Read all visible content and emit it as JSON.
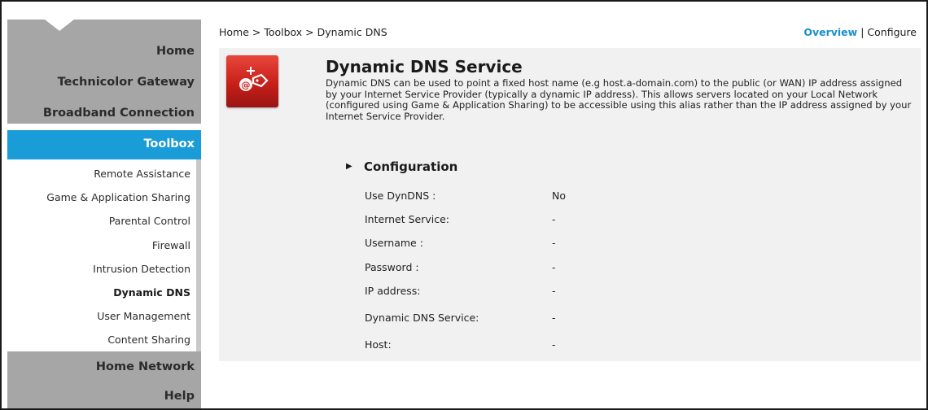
{
  "sidebar": {
    "headers": [
      "Home",
      "Technicolor Gateway",
      "Broadband Connection"
    ],
    "active_section": "Toolbox",
    "items": [
      {
        "label": "Remote Assistance"
      },
      {
        "label": "Game & Application Sharing"
      },
      {
        "label": "Parental Control"
      },
      {
        "label": "Firewall"
      },
      {
        "label": "Intrusion Detection"
      },
      {
        "label": "Dynamic DNS",
        "active": true
      },
      {
        "label": "User Management"
      },
      {
        "label": "Content Sharing"
      }
    ],
    "footer": [
      "Home Network",
      "Help"
    ]
  },
  "breadcrumb": "Home > Toolbox > Dynamic DNS",
  "top_links": {
    "overview": "Overview",
    "separator": "|",
    "configure": "Configure"
  },
  "service": {
    "icon": "dns-at-tag-icon",
    "title": "Dynamic DNS Service",
    "description": "Dynamic DNS can be used to point a fixed host name (e.g host.a-domain.com) to the public (or WAN) IP address assigned by your Internet Service Provider (typically a dynamic IP address). This allows servers located on your Local Network (configured using Game & Application Sharing) to be accessible using this alias rather than the IP address assigned by your Internet Service Provider."
  },
  "configuration": {
    "title": "Configuration",
    "rows": [
      {
        "label": "Use DynDNS :",
        "value": "No"
      },
      {
        "label": "Internet Service:",
        "value": "-"
      },
      {
        "label": "Username :",
        "value": "-"
      },
      {
        "label": "Password :",
        "value": "-"
      },
      {
        "label": "IP address:",
        "value": "-"
      },
      {
        "label": "Dynamic DNS Service:",
        "value": "-"
      },
      {
        "label": "Host:",
        "value": "-"
      }
    ]
  },
  "colors": {
    "accent": "#199cd8",
    "sidebar_gray": "#a6a6a6",
    "panel": "#f1f1f1",
    "icon_red": "#c8201a"
  }
}
